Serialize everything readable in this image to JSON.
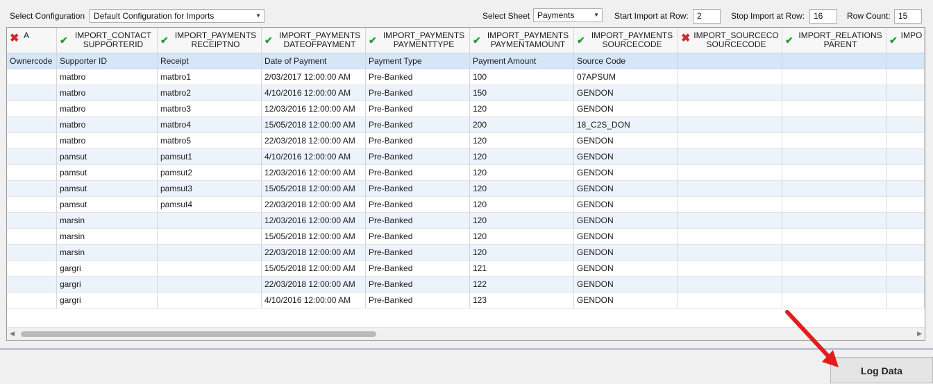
{
  "toolbar": {
    "select_config_label": "Select Configuration",
    "config_value": "Default Configuration for Imports",
    "select_sheet_label": "Select Sheet",
    "sheet_value": "Payments",
    "start_row_label": "Start Import at Row:",
    "start_row_value": "2",
    "stop_row_label": "Stop Import at Row:",
    "stop_row_value": "16",
    "row_count_label": "Row Count:",
    "row_count_value": "15"
  },
  "columns": [
    {
      "mapping": "A",
      "status": "error",
      "label": "Ownercode"
    },
    {
      "mapping": "IMPORT_CONTACT\nSUPPORTERID",
      "status": "ok",
      "label": "Supporter ID"
    },
    {
      "mapping": "IMPORT_PAYMENTS\nRECEIPTNO",
      "status": "ok",
      "label": "Receipt"
    },
    {
      "mapping": "IMPORT_PAYMENTS\nDATEOFPAYMENT",
      "status": "ok",
      "label": "Date of Payment"
    },
    {
      "mapping": "IMPORT_PAYMENTS\nPAYMENTTYPE",
      "status": "ok",
      "label": "Payment Type"
    },
    {
      "mapping": "IMPORT_PAYMENTS\nPAYMENTAMOUNT",
      "status": "ok",
      "label": "Payment Amount"
    },
    {
      "mapping": "IMPORT_PAYMENTS\nSOURCECODE",
      "status": "ok",
      "label": "Source Code"
    },
    {
      "mapping": "IMPORT_SOURCECO\nSOURCECODE",
      "status": "error",
      "label": ""
    },
    {
      "mapping": "IMPORT_RELATIONS\nPARENT",
      "status": "ok",
      "label": ""
    },
    {
      "mapping": "IMPO",
      "status": "ok",
      "label": ""
    }
  ],
  "rows": [
    [
      "",
      "matbro",
      "matbro1",
      "2/03/2017 12:00:00 AM",
      "Pre-Banked",
      "100",
      "07APSUM",
      "",
      "",
      ""
    ],
    [
      "",
      "matbro",
      "matbro2",
      "4/10/2016 12:00:00 AM",
      "Pre-Banked",
      "150",
      "GENDON",
      "",
      "",
      ""
    ],
    [
      "",
      "matbro",
      "matbro3",
      "12/03/2016 12:00:00 AM",
      "Pre-Banked",
      "120",
      "GENDON",
      "",
      "",
      ""
    ],
    [
      "",
      "matbro",
      "matbro4",
      "15/05/2018 12:00:00 AM",
      "Pre-Banked",
      "200",
      "18_C2S_DON",
      "",
      "",
      ""
    ],
    [
      "",
      "matbro",
      "matbro5",
      "22/03/2018 12:00:00 AM",
      "Pre-Banked",
      "120",
      "GENDON",
      "",
      "",
      ""
    ],
    [
      "",
      "pamsut",
      "pamsut1",
      "4/10/2016 12:00:00 AM",
      "Pre-Banked",
      "120",
      "GENDON",
      "",
      "",
      ""
    ],
    [
      "",
      "pamsut",
      "pamsut2",
      "12/03/2016 12:00:00 AM",
      "Pre-Banked",
      "120",
      "GENDON",
      "",
      "",
      ""
    ],
    [
      "",
      "pamsut",
      "pamsut3",
      "15/05/2018 12:00:00 AM",
      "Pre-Banked",
      "120",
      "GENDON",
      "",
      "",
      ""
    ],
    [
      "",
      "pamsut",
      "pamsut4",
      "22/03/2018 12:00:00 AM",
      "Pre-Banked",
      "120",
      "GENDON",
      "",
      "",
      ""
    ],
    [
      "",
      "marsin",
      "",
      "12/03/2016 12:00:00 AM",
      "Pre-Banked",
      "120",
      "GENDON",
      "",
      "",
      ""
    ],
    [
      "",
      "marsin",
      "",
      "15/05/2018 12:00:00 AM",
      "Pre-Banked",
      "120",
      "GENDON",
      "",
      "",
      ""
    ],
    [
      "",
      "marsin",
      "",
      "22/03/2018 12:00:00 AM",
      "Pre-Banked",
      "120",
      "GENDON",
      "",
      "",
      ""
    ],
    [
      "",
      "gargri",
      "",
      "15/05/2018 12:00:00 AM",
      "Pre-Banked",
      "121",
      "GENDON",
      "",
      "",
      ""
    ],
    [
      "",
      "gargri",
      "",
      "22/03/2018 12:00:00 AM",
      "Pre-Banked",
      "122",
      "GENDON",
      "",
      "",
      ""
    ],
    [
      "",
      "gargri",
      "",
      "4/10/2016 12:00:00 AM",
      "Pre-Banked",
      "123",
      "GENDON",
      "",
      "",
      ""
    ]
  ],
  "log_button_label": "Log Data",
  "colors": {
    "ok": "#1e9e2a",
    "error": "#d9262c",
    "selected_row": "#d5e6f8",
    "arrow": "#e41c1c"
  }
}
